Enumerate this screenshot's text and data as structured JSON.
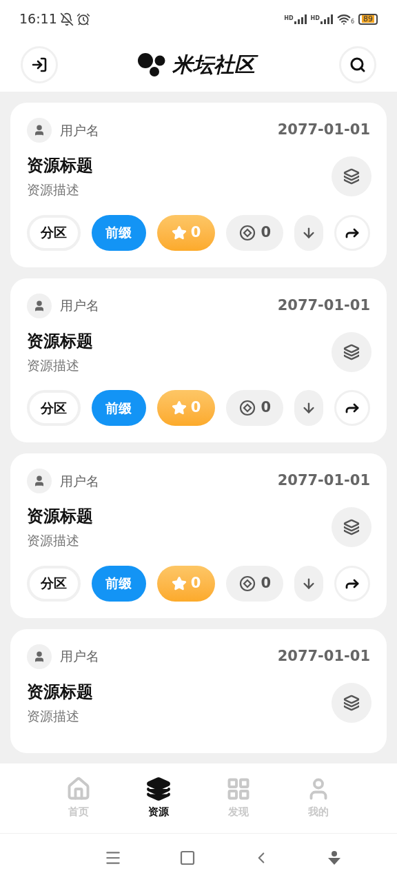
{
  "status_bar": {
    "time": "16:11",
    "signal_labels": [
      "HD",
      "HD"
    ],
    "wifi_label": "6",
    "battery": "89"
  },
  "header": {
    "title": "米坛社区"
  },
  "cards": [
    {
      "username": "用户名",
      "date": "2077-01-01",
      "title": "资源标题",
      "description": "资源描述",
      "section": "分区",
      "prefix": "前缀",
      "stars": "0",
      "coins": "0"
    },
    {
      "username": "用户名",
      "date": "2077-01-01",
      "title": "资源标题",
      "description": "资源描述",
      "section": "分区",
      "prefix": "前缀",
      "stars": "0",
      "coins": "0"
    },
    {
      "username": "用户名",
      "date": "2077-01-01",
      "title": "资源标题",
      "description": "资源描述",
      "section": "分区",
      "prefix": "前缀",
      "stars": "0",
      "coins": "0"
    },
    {
      "username": "用户名",
      "date": "2077-01-01",
      "title": "资源标题",
      "description": "资源描述"
    }
  ],
  "bottom_nav": [
    {
      "kind": "home",
      "label": "首页",
      "selected": false
    },
    {
      "kind": "resources",
      "label": "资源",
      "selected": true
    },
    {
      "kind": "discover",
      "label": "发现",
      "selected": false
    },
    {
      "kind": "profile",
      "label": "我的",
      "selected": false
    }
  ]
}
